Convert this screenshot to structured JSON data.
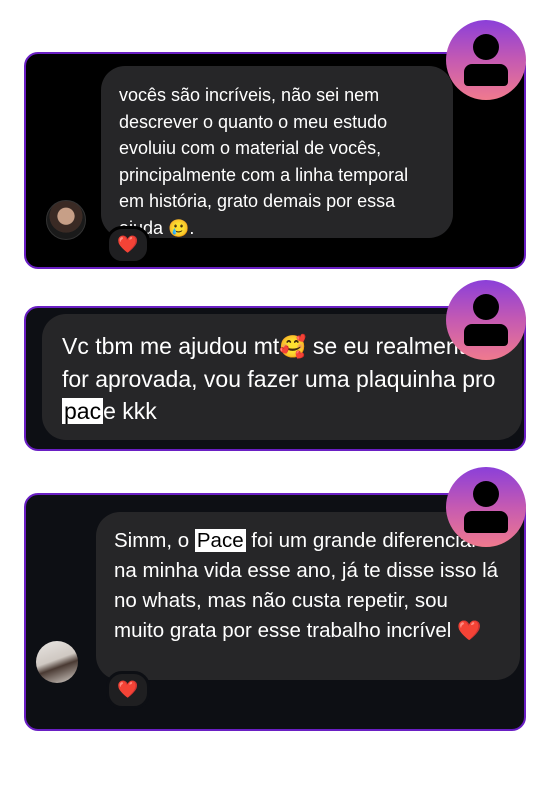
{
  "messages": [
    {
      "text_before": "vocês são incríveis, não sei nem descrever o quanto o meu estudo evoluiu com o material de vocês, principalmente com a linha temporal em história, grato demais por essa ajuda ",
      "emoji": "🥲",
      "text_after": ".",
      "reaction": "❤️"
    },
    {
      "text_before": "Vc tbm me ajudou mt",
      "emoji": "🥰",
      "text_mid": " se eu realmente for aprovada, vou fazer uma plaquinha pro ",
      "highlight": "pac",
      "text_after": "e kkk"
    },
    {
      "text_before": "Simm, o ",
      "highlight": "Pace",
      "text_after": " foi um grande diferencial na minha vida esse ano, já te disse isso lá no whats, mas não custa repetir, sou muito grata por esse trabalho incrível ",
      "emoji": "❤️",
      "reaction": "❤️"
    }
  ],
  "icons": {
    "profile": "user-silhouette-icon",
    "reaction": "heart-icon"
  },
  "colors": {
    "card_border": "#6a1fc4",
    "bubble": "#262628",
    "profile_gradient_top": "#8b3fd9",
    "profile_gradient_bottom": "#f07a8e"
  }
}
